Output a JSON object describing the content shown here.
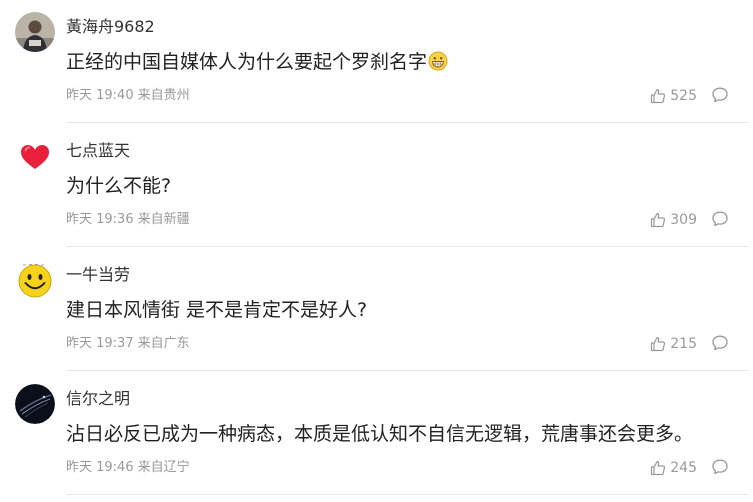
{
  "comments": [
    {
      "username": "黃海舟9682",
      "text": "正经的中国自媒体人为什么要起个罗刹名字",
      "time": "昨天 19:40",
      "location": "来自贵州",
      "likes": "525",
      "avatar": "person-photo",
      "emoji": "grinning-face-emoji"
    },
    {
      "username": "七点蓝天",
      "text": "为什么不能?",
      "time": "昨天 19:36",
      "location": "来自新疆",
      "likes": "309",
      "avatar": "red-heart"
    },
    {
      "username": "一牛当劳",
      "text": "建日本风情街 是不是肯定不是好人?",
      "time": "昨天 19:37",
      "location": "来自广东",
      "likes": "215",
      "avatar": "smiley-face"
    },
    {
      "username": "信尔之明",
      "text": "沾日必反已成为一种病态，本质是低认知不自信无逻辑，荒唐事还会更多。",
      "time": "昨天 19:46",
      "location": "来自辽宁",
      "likes": "245",
      "avatar": "dark-orbit"
    }
  ],
  "colors": {
    "username": "#333333",
    "content": "#222222",
    "meta": "#999999",
    "divider": "#e8e8e8",
    "heart": "#e8203c",
    "smiley": "#f7d21a"
  }
}
